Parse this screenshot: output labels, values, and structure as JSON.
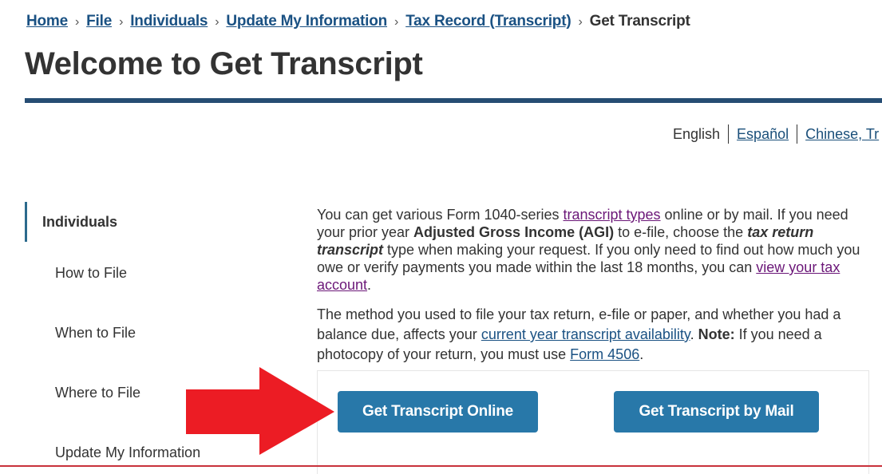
{
  "breadcrumb": {
    "items": [
      {
        "label": "Home"
      },
      {
        "label": "File"
      },
      {
        "label": "Individuals"
      },
      {
        "label": "Update My Information"
      },
      {
        "label": "Tax Record (Transcript)"
      }
    ],
    "current": "Get Transcript",
    "separator": "›"
  },
  "page": {
    "title": "Welcome to Get Transcript"
  },
  "languages": {
    "items": [
      {
        "label": "English",
        "active": true
      },
      {
        "label": "Español",
        "active": false
      },
      {
        "label": "Chinese, Tr",
        "active": false
      }
    ]
  },
  "sidenav": {
    "parent": "Individuals",
    "items": [
      {
        "label": "How to File"
      },
      {
        "label": "When to File"
      },
      {
        "label": "Where to File"
      },
      {
        "label": "Update My Information"
      }
    ]
  },
  "content": {
    "p1": {
      "t1": "You can get various Form 1040-series ",
      "link1": "transcript types",
      "t2": " online or by mail. If you need your prior year ",
      "bold1": "Adjusted Gross Income (AGI)",
      "t3": " to e-file, choose the ",
      "bolditalic1": "tax return transcript",
      "t4": " type when making your request. If you only need to find out how much you owe or verify payments you made within the last 18 months, you can ",
      "link2": "view your tax account",
      "t5": "."
    },
    "p2": {
      "t1": "The method you used to file your tax return, e-file or paper, and whether you had a balance due, affects your ",
      "link1": "current year transcript availability",
      "t2": ". ",
      "bold1": "Note:",
      "t3": " If you need a photocopy of your return, you must use ",
      "link2": "Form 4506",
      "t4": "."
    }
  },
  "buttons": {
    "online": "Get Transcript Online",
    "mail": "Get Transcript by Mail"
  },
  "annotation": {
    "arrow_icon": "red-arrow-right",
    "color": "#ec1c24"
  },
  "colors": {
    "link": "#1a5183",
    "visited_link": "#6b1778",
    "rule": "#264d73",
    "button": "#2878a9"
  }
}
